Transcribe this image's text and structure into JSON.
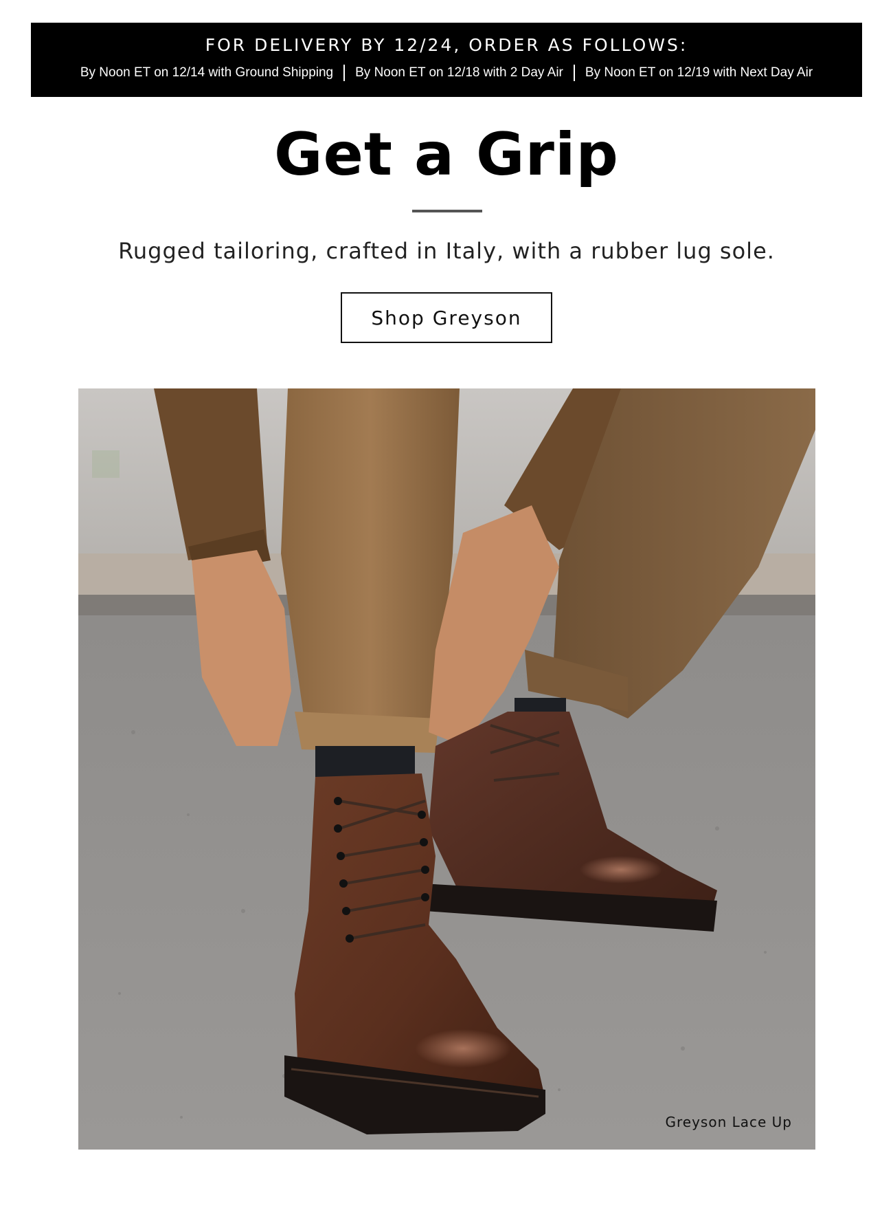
{
  "banner": {
    "title": "FOR DELIVERY BY 12/24, ORDER AS FOLLOWS:",
    "options": [
      "By Noon ET on 12/14 with Ground Shipping",
      "By Noon ET on 12/18 with 2 Day Air",
      "By Noon ET on 12/19 with Next Day Air"
    ]
  },
  "hero": {
    "headline": "Get a Grip",
    "subhead": "Rugged tailoring, crafted in Italy, with a rubber lug sole.",
    "cta_label": "Shop Greyson",
    "image_caption": "Greyson Lace Up"
  },
  "colors": {
    "banner_bg": "#000000",
    "banner_text": "#ffffff",
    "headline": "#000000",
    "divider": "#555555",
    "button_border": "#111111"
  }
}
